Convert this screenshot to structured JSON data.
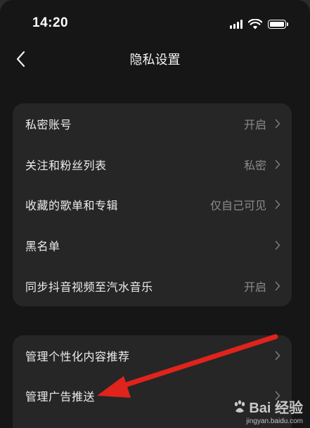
{
  "status_bar": {
    "time": "14:20",
    "battery_level": 0.85
  },
  "header": {
    "title": "隐私设置"
  },
  "group1": {
    "items": [
      {
        "label": "私密账号",
        "value": "开启"
      },
      {
        "label": "关注和粉丝列表",
        "value": "私密"
      },
      {
        "label": "收藏的歌单和专辑",
        "value": "仅自己可见"
      },
      {
        "label": "黑名单",
        "value": ""
      },
      {
        "label": "同步抖音视频至汽水音乐",
        "value": "开启"
      }
    ]
  },
  "group2": {
    "items": [
      {
        "label": "管理个性化内容推荐",
        "value": ""
      },
      {
        "label": "管理广告推送",
        "value": ""
      }
    ]
  },
  "annotation": {
    "arrow_color": "#e0231c"
  },
  "watermark": {
    "brand": "Bai 经验",
    "url": "jingyan.baidu.com"
  }
}
